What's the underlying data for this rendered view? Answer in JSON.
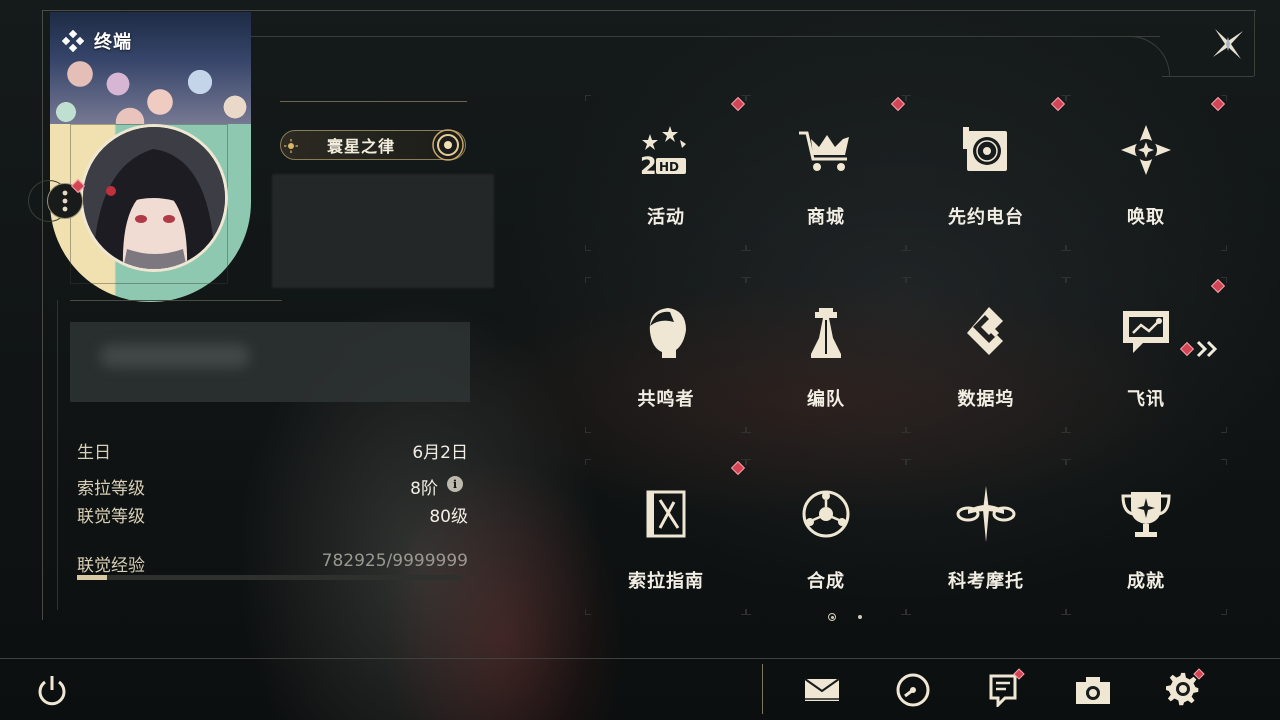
{
  "card": {
    "title": "终端"
  },
  "title_badge": {
    "label": "寰星之律"
  },
  "stats": {
    "birthday_label": "生日",
    "birthday_value": "6月2日",
    "sola_label": "索拉等级",
    "sola_value": "8阶",
    "union_label": "联觉等级",
    "union_value": "80级",
    "exp_label": "联觉经验",
    "exp_value": "782925/9999999",
    "exp_progress": 0.078
  },
  "grid": [
    {
      "label": "活动",
      "icon": "event-2hd-icon",
      "alert": true
    },
    {
      "label": "商城",
      "icon": "shop-crown-cart-icon",
      "alert": true
    },
    {
      "label": "先约电台",
      "icon": "radio-vinyl-icon",
      "alert": true
    },
    {
      "label": "唤取",
      "icon": "convene-star-icon",
      "alert": true
    },
    {
      "label": "共鸣者",
      "icon": "resonator-profile-icon",
      "alert": false
    },
    {
      "label": "编队",
      "icon": "team-chess-icon",
      "alert": false
    },
    {
      "label": "数据坞",
      "icon": "data-bank-icon",
      "alert": false
    },
    {
      "label": "飞讯",
      "icon": "message-bubble-icon",
      "alert": true
    },
    {
      "label": "索拉指南",
      "icon": "guidebook-icon",
      "alert": true
    },
    {
      "label": "合成",
      "icon": "synthesis-icon",
      "alert": false
    },
    {
      "label": "科考摩托",
      "icon": "motorbike-icon",
      "alert": false
    },
    {
      "label": "成就",
      "icon": "trophy-icon",
      "alert": false
    }
  ],
  "pagination": {
    "current": 1,
    "total": 2
  },
  "bottom_bar": {
    "power": "power-icon",
    "mail": {
      "icon": "mail-icon",
      "alert": false
    },
    "events": {
      "icon": "clock-icon",
      "alert": false
    },
    "notice": {
      "icon": "notice-board-icon",
      "alert": true
    },
    "photo": {
      "icon": "camera-icon",
      "alert": false
    },
    "settings": {
      "icon": "gear-icon",
      "alert": true
    }
  },
  "colors": {
    "accent_gold": "#d8c9a2",
    "alert_red": "#d34555",
    "text_light": "#f2eee4"
  }
}
